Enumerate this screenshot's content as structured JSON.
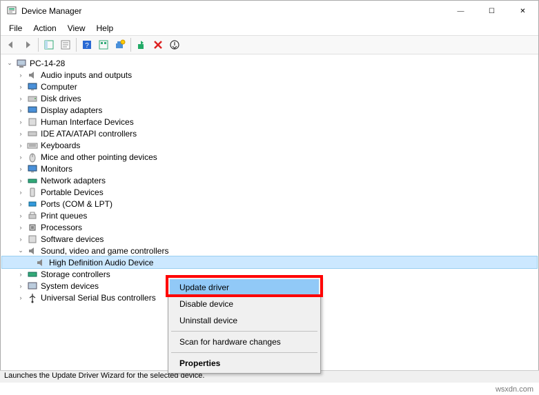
{
  "window": {
    "title": "Device Manager"
  },
  "menu": {
    "file": "File",
    "action": "Action",
    "view": "View",
    "help": "Help"
  },
  "tree": {
    "root": "PC-14-28",
    "items": [
      "Audio inputs and outputs",
      "Computer",
      "Disk drives",
      "Display adapters",
      "Human Interface Devices",
      "IDE ATA/ATAPI controllers",
      "Keyboards",
      "Mice and other pointing devices",
      "Monitors",
      "Network adapters",
      "Portable Devices",
      "Ports (COM & LPT)",
      "Print queues",
      "Processors",
      "Software devices",
      "Sound, video and game controllers",
      "Storage controllers",
      "System devices",
      "Universal Serial Bus controllers"
    ],
    "selected_child": "High Definition Audio Device"
  },
  "context_menu": {
    "update": "Update driver",
    "disable": "Disable device",
    "uninstall": "Uninstall device",
    "scan": "Scan for hardware changes",
    "properties": "Properties"
  },
  "status": "Launches the Update Driver Wizard for the selected device.",
  "watermark": "wsxdn.com"
}
